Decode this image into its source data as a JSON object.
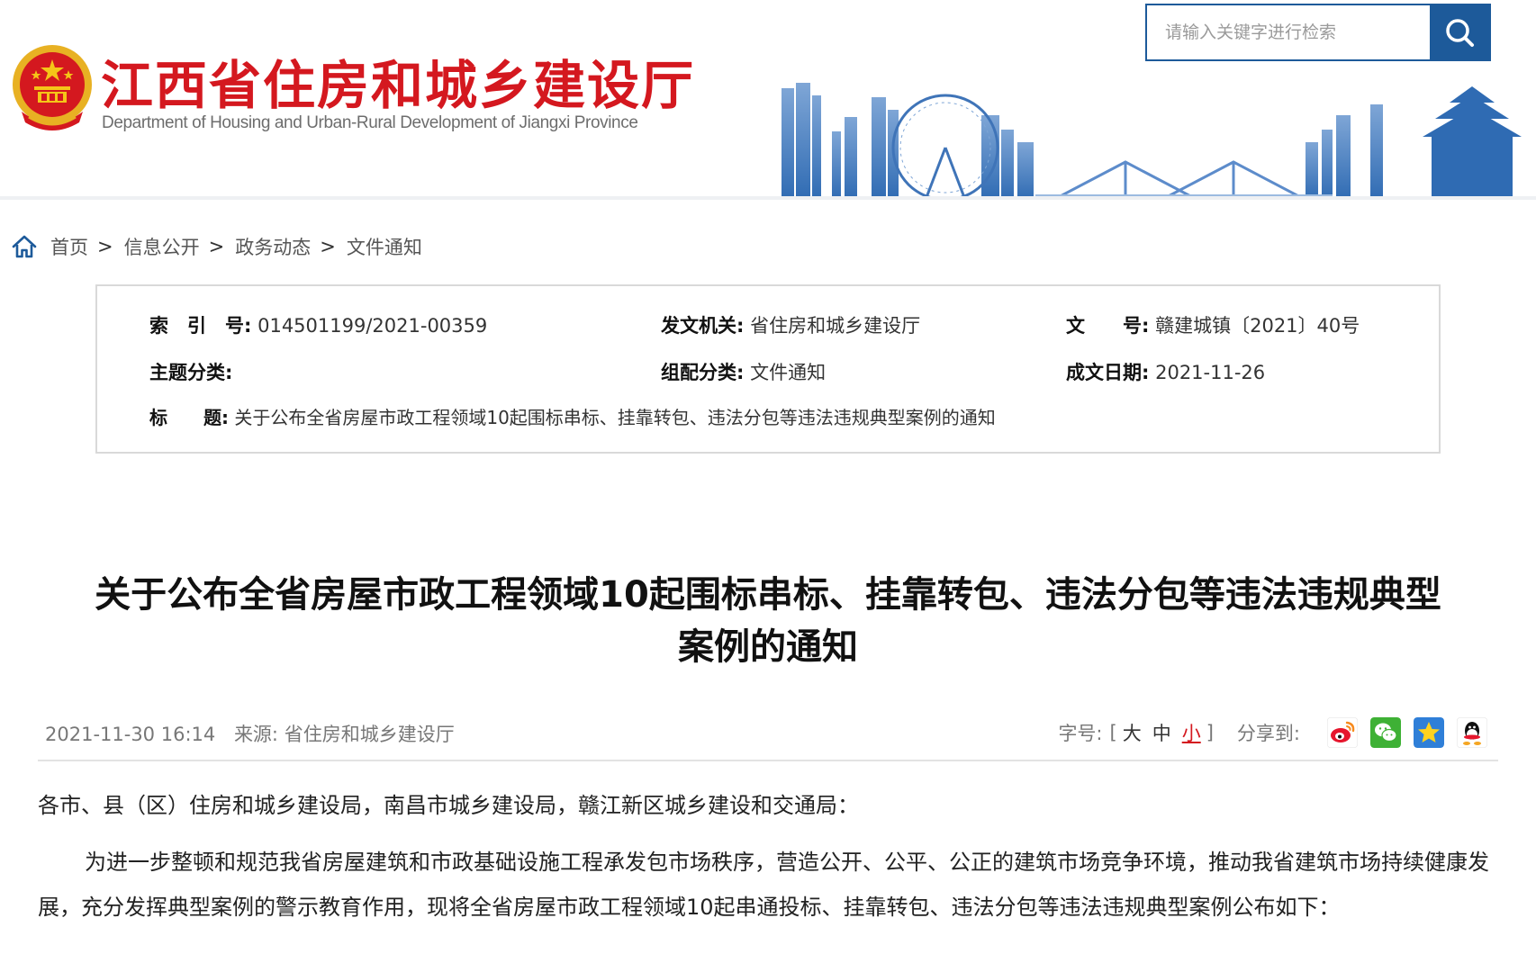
{
  "site": {
    "title": "江西省住房和城乡建设厅",
    "subtitle": "Department of Housing and Urban-Rural Development of Jiangxi Province",
    "search_placeholder": "请输入关键字进行检索",
    "emblem_icon": "national-emblem-icon",
    "search_icon": "search-icon"
  },
  "breadcrumb": {
    "home_icon": "home-icon",
    "items": [
      "首页",
      "信息公开",
      "政务动态",
      "文件通知"
    ],
    "separator": ">"
  },
  "meta": {
    "index_key": "索　引　号:",
    "index_val": "014501199/2021-00359",
    "issuer_key": "发文机关:",
    "issuer_val": "省住房和城乡建设厅",
    "docno_key": "文　　号:",
    "docno_val": "赣建城镇〔2021〕40号",
    "topic_key": "主题分类:",
    "topic_val": "",
    "group_key": "组配分类:",
    "group_val": "文件通知",
    "date_key": "成文日期:",
    "date_val": "2021-11-26",
    "title_key": "标　　题:",
    "title_val": "关于公布全省房屋市政工程领域10起围标串标、挂靠转包、违法分包等违法违规典型案例的通知"
  },
  "article": {
    "title_line1": "关于公布全省房屋市政工程领域10起围标串标、挂靠转包、违法分包等违法违规典型",
    "title_line2": "案例的通知",
    "datetime": "2021-11-30 16:14",
    "source_label": "来源:",
    "source": "省住房和城乡建设厅",
    "fontsize_label": "字号:",
    "bracket_open": "[",
    "bracket_close": "]",
    "fontsize_large": "大",
    "fontsize_medium": "中",
    "fontsize_small": "小",
    "share_label": "分享到:",
    "share_icons": [
      "weibo-icon",
      "wechat-icon",
      "favorite-star-icon",
      "qq-icon"
    ],
    "salutation": "各市、县（区）住房和城乡建设局，南昌市城乡建设局，赣江新区城乡建设和交通局：",
    "paragraph": "为进一步整顿和规范我省房屋建筑和市政基础设施工程承发包市场秩序，营造公开、公平、公正的建筑市场竞争环境，推动我省建筑市场持续健康发展，充分发挥典型案例的警示教育作用，现将全省房屋市政工程领域10起串通投标、挂靠转包、违法分包等违法违规典型案例公布如下："
  },
  "colors": {
    "brand_red": "#d4181f",
    "brand_blue": "#1d5a9a",
    "text": "#222222",
    "muted": "#777777"
  }
}
